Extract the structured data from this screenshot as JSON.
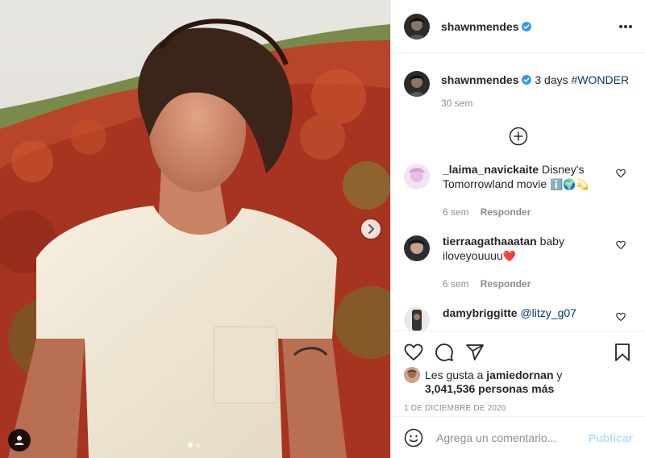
{
  "header": {
    "username": "shawnmendes",
    "avatar_icon": "profile-avatar",
    "more_icon": "more-options-icon"
  },
  "caption": {
    "username": "shawnmendes",
    "text": " 3 days ",
    "hashtag": "#WONDER",
    "time": "30 sem"
  },
  "load_more_icon": "plus-circle-icon",
  "comments": [
    {
      "username": "_laima_navickaite",
      "text": " Disney's Tomorrowland movie ",
      "emojis": "ℹ️🌍💫",
      "time": "6 sem",
      "reply": "Responder"
    },
    {
      "username": "tierraagathaaatan",
      "text": " baby iloveyouuuu",
      "emojis": "❤️",
      "time": "6 sem",
      "reply": "Responder"
    },
    {
      "username": "damybriggitte",
      "mention": "@litzy_g07"
    }
  ],
  "likes": {
    "prefix": "Les gusta a ",
    "user": "jamiedornan",
    "suffix": " y",
    "count": "3,041,536 personas más"
  },
  "date": "1 DE DICIEMBRE DE 2020",
  "add_comment": {
    "placeholder": "Agrega un comentario...",
    "publish": "Publicar"
  },
  "carousel": {
    "slide": 1,
    "total": 2
  },
  "colors": {
    "link": "#00376b",
    "verified": "#3897f0",
    "publish_disabled": "#b2dffc",
    "muted": "#8e8e8e"
  }
}
